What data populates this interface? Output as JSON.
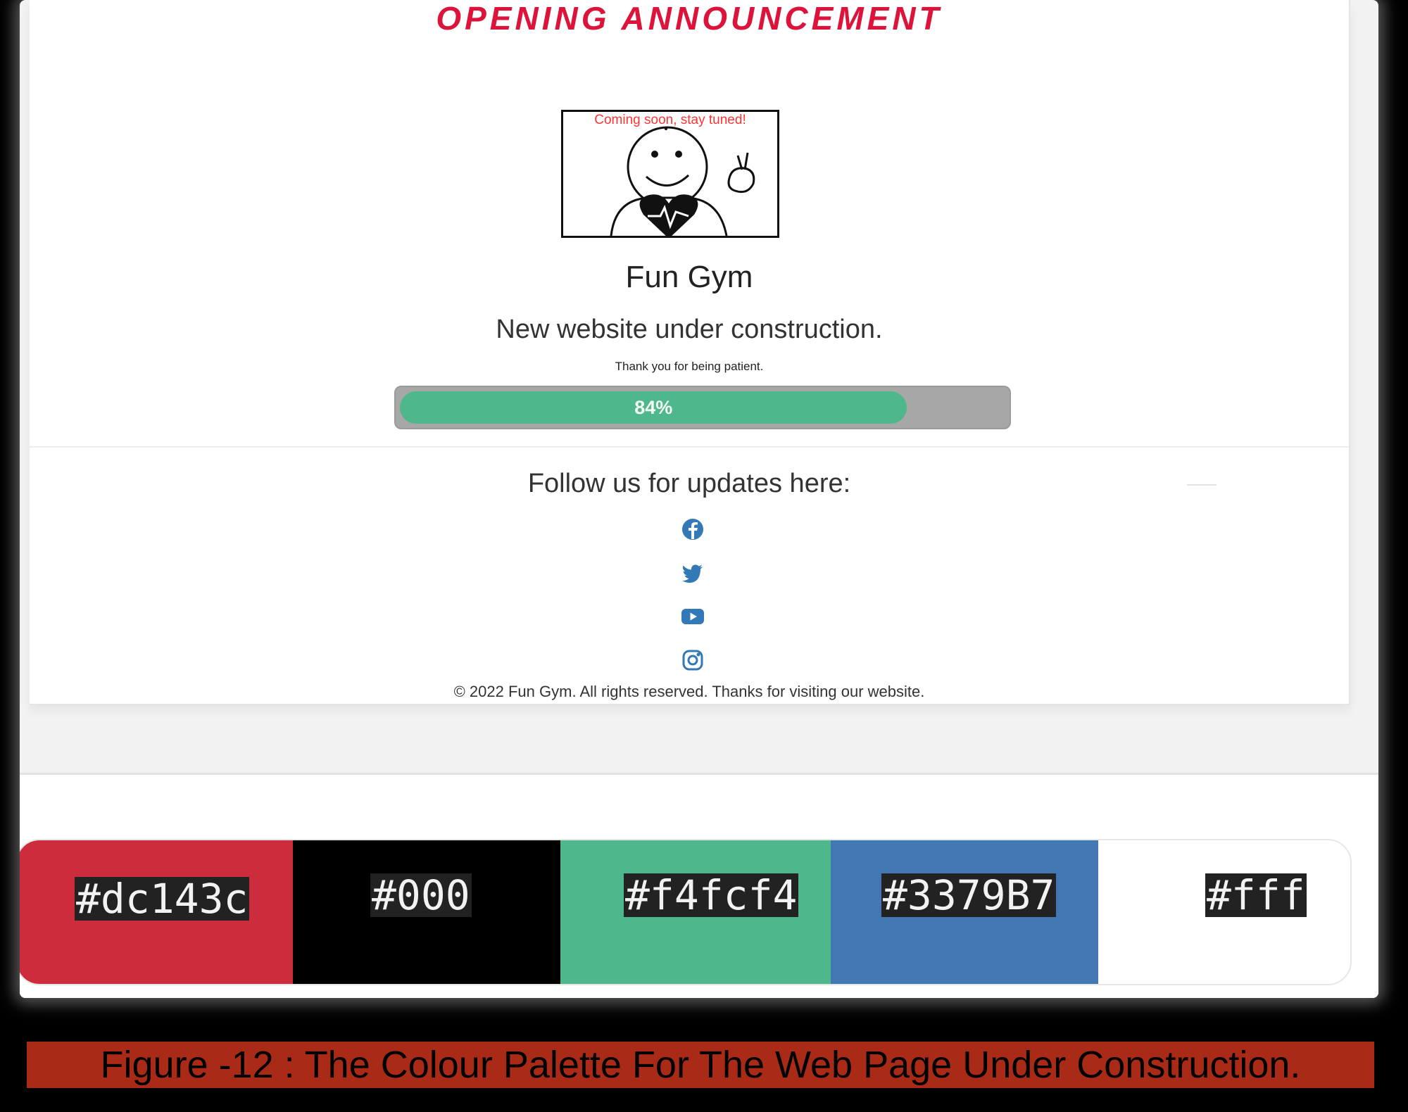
{
  "announcement": {
    "title": "OPENING ANNOUNCEMENT"
  },
  "hero": {
    "caption": "Coming soon, stay tuned!",
    "image": "smiley-peace-heart-illustration"
  },
  "brand": {
    "name": "Fun Gym"
  },
  "status": {
    "headline": "New website under construction.",
    "subtext": "Thank you for being patient.",
    "progress_label": "84%",
    "progress_value": 0.84
  },
  "social": {
    "heading": "Follow us for updates here:",
    "icons": [
      "facebook-icon",
      "twitter-icon",
      "youtube-icon",
      "instagram-icon"
    ],
    "icon_color": "#3379B7"
  },
  "footer": {
    "copyright": "© 2022 Fun Gym. All rights reserved. Thanks for visiting our website."
  },
  "palette": {
    "swatches": [
      {
        "label": "#dc143c",
        "color": "#cc2c3c"
      },
      {
        "label": "#000",
        "color": "#000000"
      },
      {
        "label": "#f4fcf4",
        "color": "#4fb78c"
      },
      {
        "label": "#3379B7",
        "color": "#4277b3"
      },
      {
        "label": "#fff",
        "color": "#ffffff"
      }
    ]
  },
  "figure": {
    "caption": "Figure -12 : The Colour Palette For The Web Page Under Construction."
  }
}
